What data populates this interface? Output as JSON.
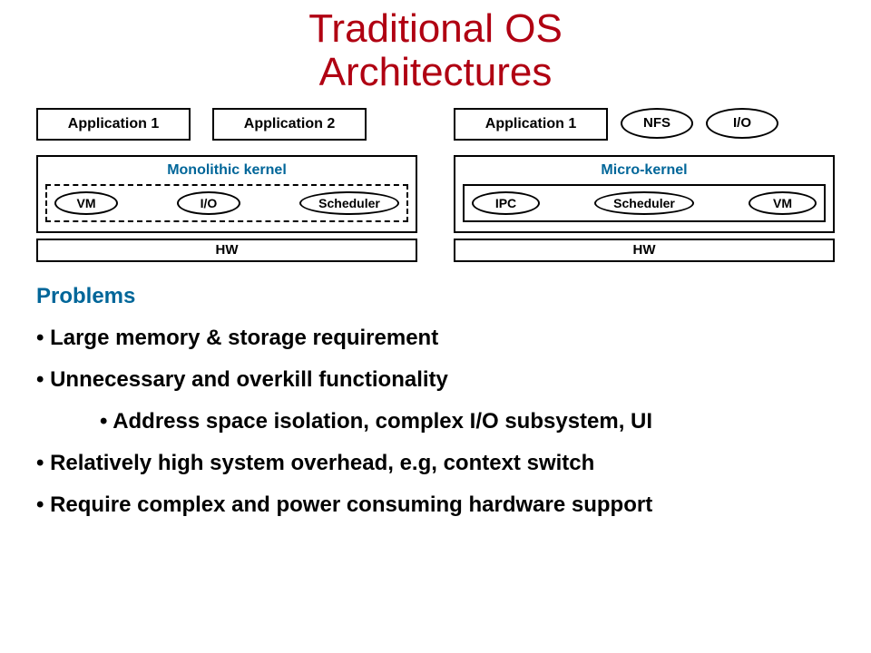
{
  "title_line1": "Traditional OS",
  "title_line2": "Architectures",
  "left": {
    "app1": "Application 1",
    "app2": "Application 2",
    "kernel_label": "Monolithic kernel",
    "comp1": "VM",
    "comp2": "I/O",
    "comp3": "Scheduler",
    "hw": "HW"
  },
  "right": {
    "app1": "Application 1",
    "srv1": "NFS",
    "srv2": "I/O",
    "kernel_label": "Micro-kernel",
    "comp1": "IPC",
    "comp2": "Scheduler",
    "comp3": "VM",
    "hw": "HW"
  },
  "problems": {
    "heading": "Problems",
    "b1": "Large memory & storage requirement",
    "b2": "Unnecessary and overkill functionality",
    "b2a": "Address space isolation, complex I/O subsystem, UI",
    "b3": "Relatively high system overhead, e.g, context switch",
    "b4": "Require complex and power consuming hardware support"
  }
}
